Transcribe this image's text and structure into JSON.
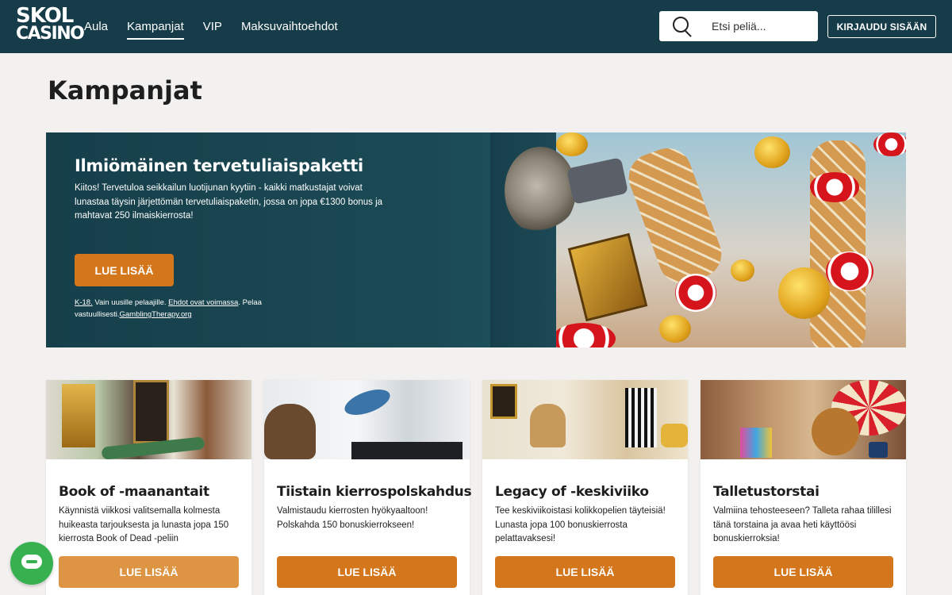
{
  "header": {
    "logo_line1": "SKOL",
    "logo_line2": "CASINO",
    "nav": [
      {
        "label": "Aula",
        "active": false
      },
      {
        "label": "Kampanjat",
        "active": true
      },
      {
        "label": "VIP",
        "active": false
      },
      {
        "label": "Maksuvaihtoehdot",
        "active": false
      }
    ],
    "search_placeholder": "Etsi peliä...",
    "login_label": "KIRJAUDU SISÄÄN",
    "search_icon": "search-icon"
  },
  "page_title": "Kampanjat",
  "hero": {
    "title": "Ilmiömäinen tervetuliaispaketti",
    "text": "Kiitos! Tervetuloa seikkailun luotijunan kyytiin - kaikki matkustajat voivat lunastaa täysin järjettömän tervetuliaispaketin, jossa on jopa €1300 bonus ja mahtavat 250 ilmaiskierrosta!",
    "button_label": "LUE LISÄÄ",
    "legal": {
      "age": "K-18.",
      "new_players": " Vain uusille pelaajille. ",
      "terms": "Ehdot ovat voimassa",
      "play_resp": ". Pelaa vastuullisesti.",
      "link": "GamblingTherapy.org"
    }
  },
  "cards": [
    {
      "title": "Book of -maanantait",
      "text": "Käynnistä viikkosi valitsemalla kolmesta huikeasta tarjouksesta ja lunasta jopa 150 kierrosta Book of Dead -peliin",
      "button_label": "LUE LISÄÄ"
    },
    {
      "title": "Tiistain kierrospolskahdus",
      "text": "Valmistaudu kierrosten hyökyaaltoon! Polskahda 150 bonuskierrokseen!",
      "button_label": "LUE LISÄÄ"
    },
    {
      "title": "Legacy of -keskiviiko",
      "text": "Tee keskiviikoistasi kolikkopelien täyteisiä! Lunasta jopa 100 bonuskierrosta pelattavaksesi!",
      "button_label": "LUE LISÄÄ"
    },
    {
      "title": "Talletustorstai",
      "text": "Valmiina tehosteeseen? Talleta rahaa tilillesi tänä torstaina ja avaa heti käyttöösi bonuskierroksia!",
      "button_label": "LUE LISÄÄ"
    }
  ],
  "colors": {
    "header_bg": "#163b49",
    "accent": "#d4771c",
    "chat": "#37b04f"
  },
  "chat_icon": "chat-icon"
}
